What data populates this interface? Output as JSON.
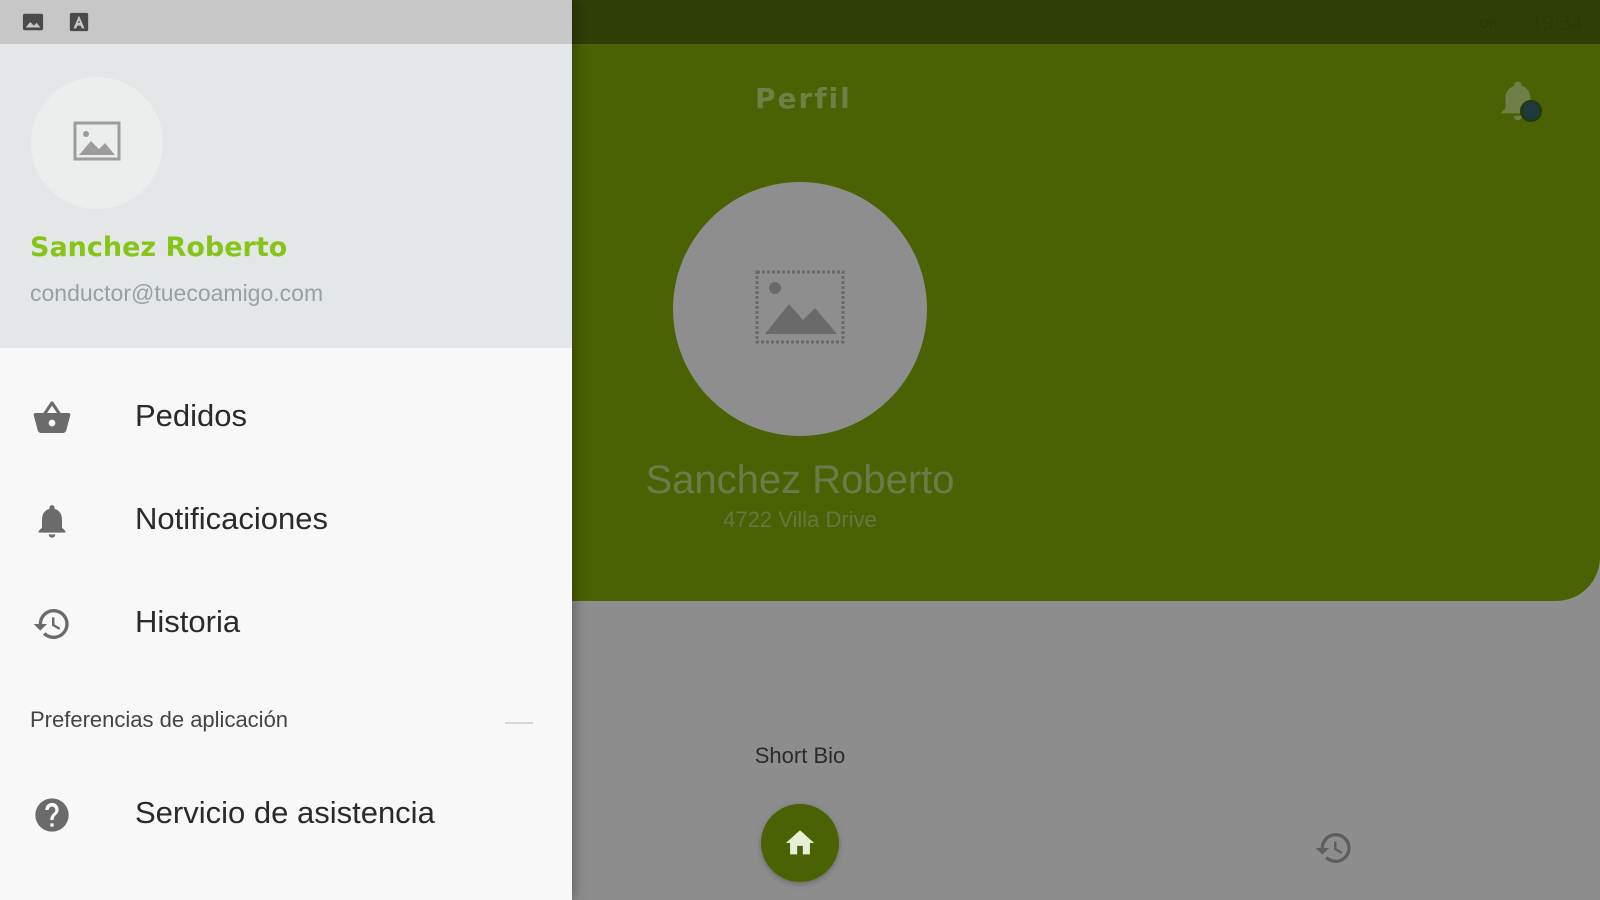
{
  "status_bar": {
    "right_text": "On",
    "clock": "19:34"
  },
  "app": {
    "title": "Perfil",
    "profile": {
      "name": "Sanchez Roberto",
      "address": "4722 Villa Drive"
    },
    "short_bio_label": "Short Bio",
    "colors": {
      "header": "#4a6203",
      "accent": "#86c517",
      "dim_overlay": "#8d8d8d"
    }
  },
  "drawer": {
    "user_name": "Sanchez Roberto",
    "user_email": "conductor@tuecoamigo.com",
    "items": [
      {
        "label": "Pedidos",
        "icon": "basket-icon"
      },
      {
        "label": "Notificaciones",
        "icon": "bell-icon"
      },
      {
        "label": "Historia",
        "icon": "history-icon"
      }
    ],
    "section_label": "Preferencias de aplicación",
    "help_item": {
      "label": "Servicio de asistencia",
      "icon": "help-icon"
    }
  }
}
